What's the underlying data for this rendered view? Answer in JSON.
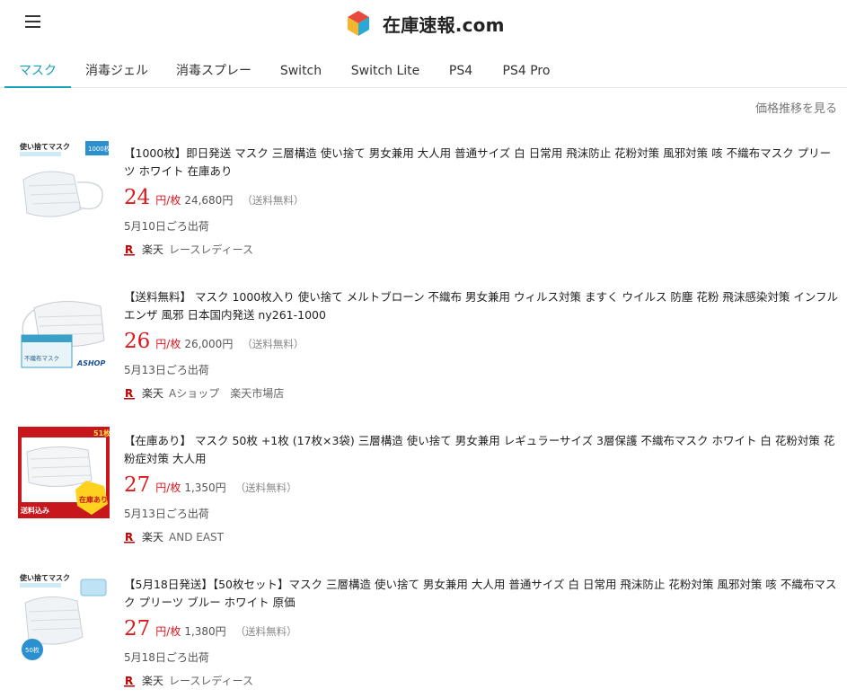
{
  "header": {
    "site_title": "在庫速報.com",
    "menu_icon": "hamburger-icon",
    "logo_icon": "cube-logo-icon"
  },
  "tabs": [
    {
      "label": "マスク",
      "active": true
    },
    {
      "label": "消毒ジェル",
      "active": false
    },
    {
      "label": "消毒スプレー",
      "active": false
    },
    {
      "label": "Switch",
      "active": false
    },
    {
      "label": "Switch Lite",
      "active": false
    },
    {
      "label": "PS4",
      "active": false
    },
    {
      "label": "PS4 Pro",
      "active": false
    }
  ],
  "history_link": "価格推移を見る",
  "items": [
    {
      "title": "【1000枚】即日発送 マスク 三層構造 使い捨て 男女兼用 大人用 普通サイズ 白 日常用 飛沫防止 花粉対策 風邪対策 咳 不織布マスク プリーツ ホワイト 在庫あり",
      "price": "24",
      "unit": "円/枚",
      "total": "24,680円",
      "shipping": "（送料無料）",
      "delivery": "5月10日ごろ出荷",
      "market": "楽天",
      "shop": "レースレディース",
      "thumb_labels": [
        "使い捨てマスク",
        "1000枚"
      ]
    },
    {
      "title": "【送料無料】 マスク 1000枚入り 使い捨て メルトブローン 不織布 男女兼用 ウィルス対策 ますく ウイルス 防塵 花粉 飛沫感染対策 インフルエンザ 風邪 日本国内発送 ny261-1000",
      "price": "26",
      "unit": "円/枚",
      "total": "26,000円",
      "shipping": "（送料無料）",
      "delivery": "5月13日ごろ出荷",
      "market": "楽天",
      "shop": "Aショップ　楽天市場店",
      "thumb_labels": [
        "不織布マスク",
        "ASHOP"
      ]
    },
    {
      "title": "【在庫あり】 マスク 50枚 +1枚 (17枚×3袋) 三層構造 使い捨て 男女兼用 レギュラーサイズ 3層保護 不織布マスク ホワイト 白 花粉対策 花粉症対策 大人用",
      "price": "27",
      "unit": "円/枚",
      "total": "1,350円",
      "shipping": "（送料無料）",
      "delivery": "5月13日ごろ出荷",
      "market": "楽天",
      "shop": "AND EAST",
      "thumb_labels": [
        "51枚",
        "送料込み",
        "在庫あり"
      ]
    },
    {
      "title": "【5月18日発送】【50枚セット】マスク 三層構造 使い捨て 男女兼用 大人用 普通サイズ 白 日常用 飛沫防止 花粉対策 風邪対策 咳 不織布マスク プリーツ ブルー ホワイト 原価",
      "price": "27",
      "unit": "円/枚",
      "total": "1,380円",
      "shipping": "（送料無料）",
      "delivery": "5月18日ごろ出荷",
      "market": "楽天",
      "shop": "レースレディース",
      "thumb_labels": [
        "使い捨てマスク",
        "50枚"
      ]
    }
  ],
  "colors": {
    "accent": "#16a2b8",
    "price": "#e0161b",
    "rakuten": "#bf0000"
  }
}
